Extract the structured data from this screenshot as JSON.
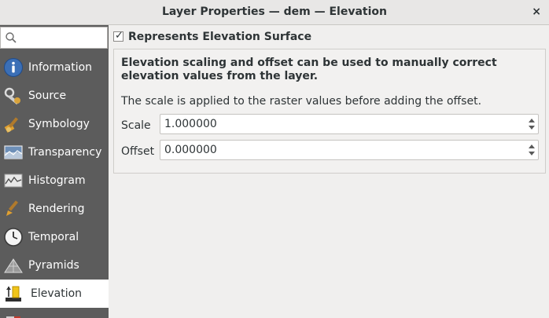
{
  "window": {
    "title": "Layer Properties — dem — Elevation",
    "close_glyph": "×"
  },
  "sidebar": {
    "search_placeholder": "",
    "items": [
      {
        "label": "Information",
        "icon": "info-icon"
      },
      {
        "label": "Source",
        "icon": "source-icon"
      },
      {
        "label": "Symbology",
        "icon": "symbology-icon"
      },
      {
        "label": "Transparency",
        "icon": "transparency-icon"
      },
      {
        "label": "Histogram",
        "icon": "histogram-icon"
      },
      {
        "label": "Rendering",
        "icon": "rendering-icon"
      },
      {
        "label": "Temporal",
        "icon": "temporal-icon"
      },
      {
        "label": "Pyramids",
        "icon": "pyramids-icon"
      },
      {
        "label": "Elevation",
        "icon": "elevation-icon",
        "active": true
      }
    ]
  },
  "elevation": {
    "checkbox_label": "Represents Elevation Surface",
    "checked": true,
    "description_bold": "Elevation scaling and offset can be used to manually correct elevation values from the layer.",
    "description": "The scale is applied to the raster values before adding the offset.",
    "scale_label": "Scale",
    "scale_value": "1.000000",
    "offset_label": "Offset",
    "offset_value": "0.000000"
  },
  "colors": {
    "sidebar_bg": "#5c5c5c",
    "active_item_bg": "#ffffff",
    "info_blue": "#3b6fb6"
  }
}
